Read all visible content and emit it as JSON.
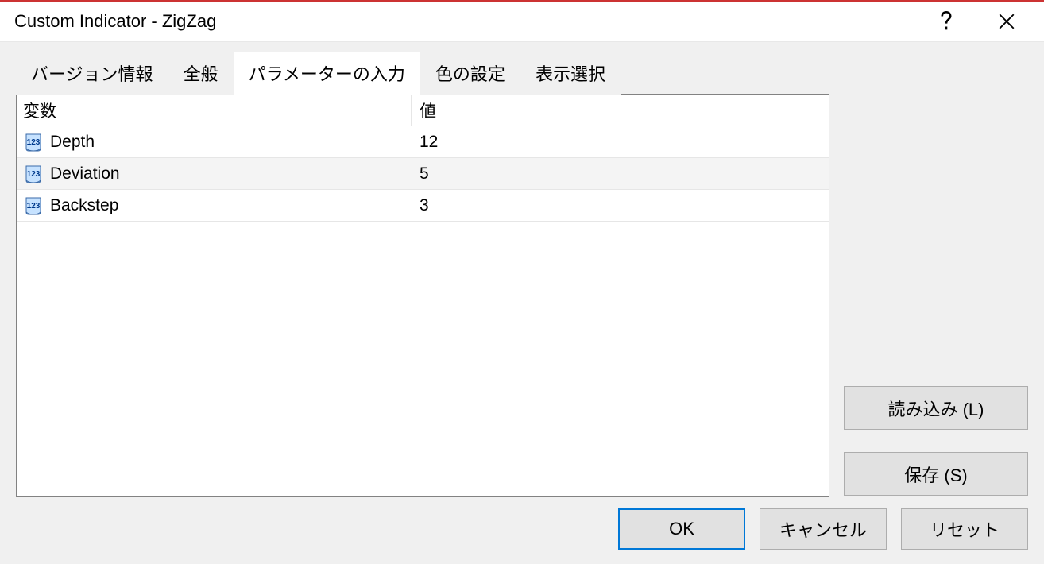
{
  "title": "Custom Indicator - ZigZag",
  "tabs": [
    {
      "label": "バージョン情報",
      "active": false
    },
    {
      "label": "全般",
      "active": false
    },
    {
      "label": "パラメーターの入力",
      "active": true
    },
    {
      "label": "色の設定",
      "active": false
    },
    {
      "label": "表示選択",
      "active": false
    }
  ],
  "table": {
    "headers": {
      "variable": "変数",
      "value": "値"
    },
    "rows": [
      {
        "name": "Depth",
        "value": "12"
      },
      {
        "name": "Deviation",
        "value": "5"
      },
      {
        "name": "Backstep",
        "value": "3"
      }
    ]
  },
  "buttons": {
    "load": "読み込み (L)",
    "save": "保存 (S)",
    "ok": "OK",
    "cancel": "キャンセル",
    "reset": "リセット"
  }
}
